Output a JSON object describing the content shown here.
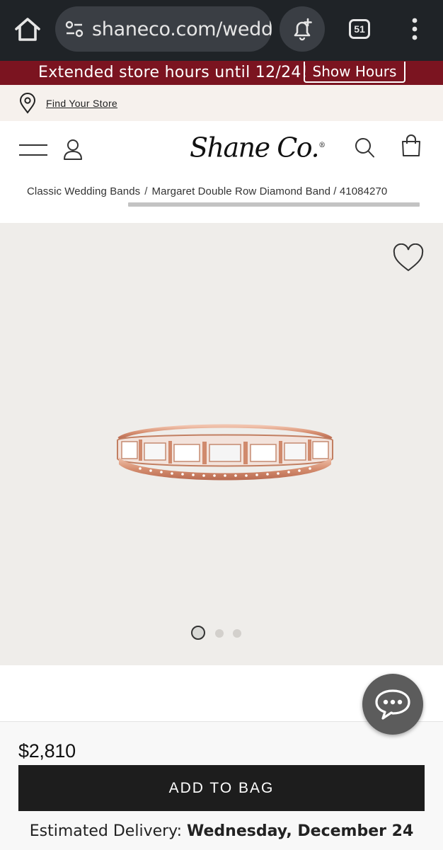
{
  "browser": {
    "url": "shaneco.com/weddi",
    "tab_count": "51"
  },
  "promo": {
    "text": "Extended store hours until 12/24!",
    "button_label": "Show Hours",
    "background_color": "#7b1420"
  },
  "store_locator": {
    "label": "Find Your Store"
  },
  "header": {
    "logo_text": "Shane Co."
  },
  "breadcrumb": {
    "items": [
      "Classic Wedding Bands",
      "Margaret Double Row Diamond Band / 41084270"
    ]
  },
  "gallery": {
    "image_alt": "rose gold double row diamond band",
    "current_slide": 1,
    "total_slides": 3
  },
  "purchase": {
    "price": "$2,810",
    "add_to_bag_label": "ADD TO BAG",
    "delivery_label": "Estimated Delivery:",
    "delivery_date": "Wednesday, December 24"
  },
  "icons": [
    "home-icon",
    "site-settings-icon",
    "add-notification-icon",
    "tab-switcher-icon",
    "more-options-icon",
    "location-pin-icon",
    "hamburger-menu-icon",
    "user-icon",
    "search-icon",
    "shopping-bag-icon",
    "heart-icon",
    "chat-icon"
  ]
}
